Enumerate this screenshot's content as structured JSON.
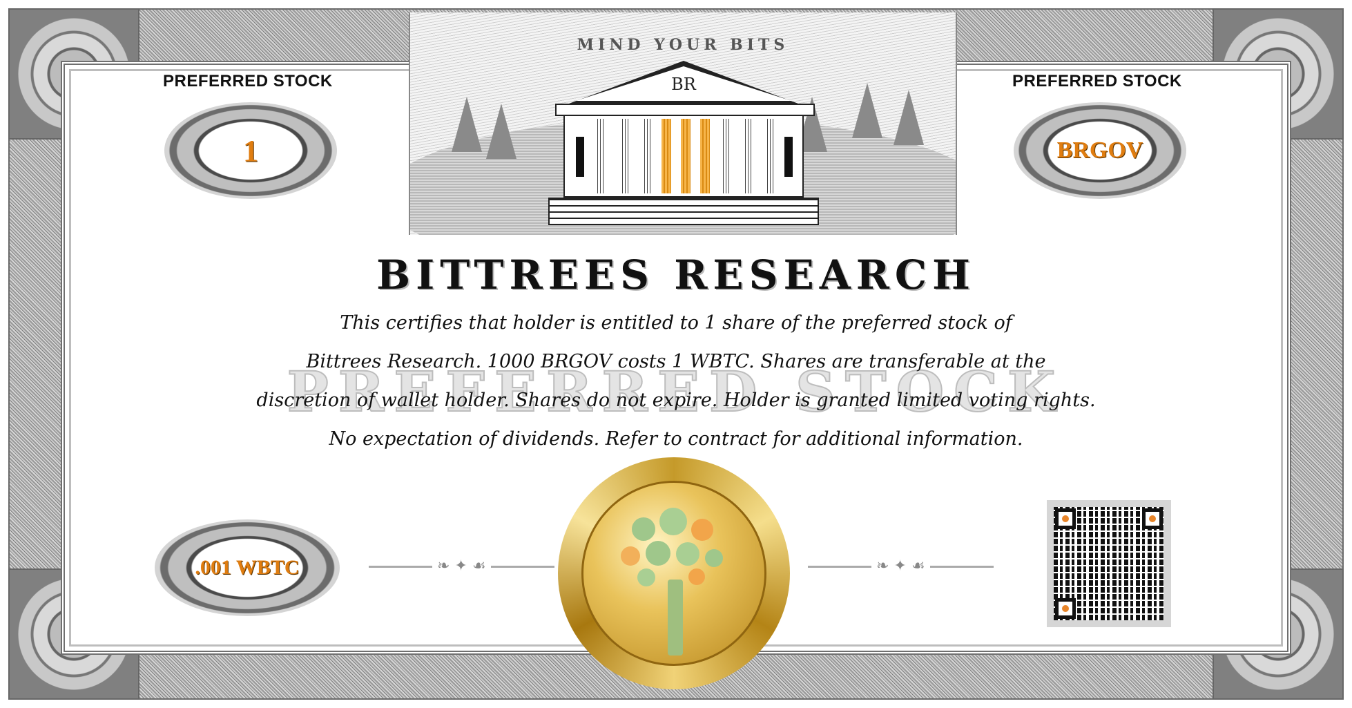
{
  "certificate": {
    "stock_type_left": "PREFERRED STOCK",
    "stock_type_right": "PREFERRED STOCK",
    "certificate_number": "1",
    "ticker": "BRGOV",
    "par_value": ".001 WBTC",
    "motto": "MIND YOUR BITS",
    "logo_monogram": "BR",
    "company_name": "BITTREES RESEARCH",
    "watermark": "PREFERRED STOCK",
    "body_lines": [
      "This certifies that holder is entitled to 1 share of the preferred stock of",
      "Bittrees Research. 1000 BRGOV costs 1 WBTC.  Shares are transferable at the",
      "discretion of wallet holder. Shares do not expire. Holder is granted limited voting rights.",
      "No expectation of dividends.  Refer to contract for additional information."
    ]
  },
  "colors": {
    "accent_orange": "#e07d10",
    "seal_gold": "#e9c35b",
    "tree_green": "#9fbf7f",
    "border_grey": "#9a9a9a"
  },
  "icons": {
    "building": "bank-building-icon",
    "seal": "gold-seal-tree-icon",
    "qr": "qr-code-icon"
  }
}
